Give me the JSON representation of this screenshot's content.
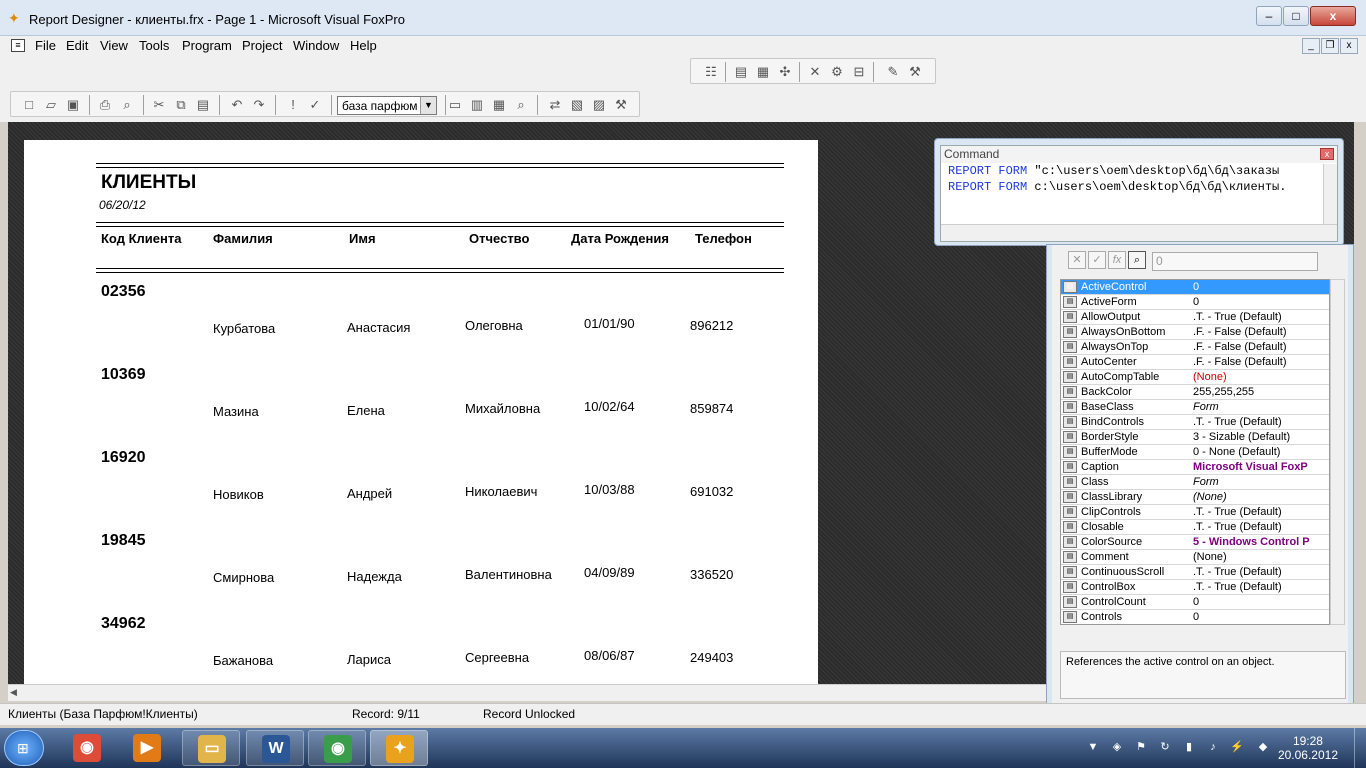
{
  "window": {
    "title": "Report Designer - клиенты.frx - Page 1 - Microsoft Visual FoxPro",
    "min": "–",
    "max": "□",
    "close": "x"
  },
  "menu": [
    "File",
    "Edit",
    "View",
    "Tools",
    "Program",
    "Project",
    "Window",
    "Help"
  ],
  "toolbar": {
    "database": "база парфюм"
  },
  "report": {
    "title": "КЛИЕНТЫ",
    "date": "06/20/12",
    "columns": [
      "Код Клиента",
      "Фамилия",
      "Имя",
      "Отчество",
      "Дата Рождения",
      "Телефон"
    ],
    "records": [
      {
        "code": "02356",
        "last": "Курбатова",
        "first": "Анастасия",
        "middle": "Олеговна",
        "dob": "01/01/90",
        "phone": "896212"
      },
      {
        "code": "10369",
        "last": "Мазина",
        "first": "Елена",
        "middle": "Михайловна",
        "dob": "10/02/64",
        "phone": "859874"
      },
      {
        "code": "16920",
        "last": "Новиков",
        "first": "Андрей",
        "middle": "Николаевич",
        "dob": "10/03/88",
        "phone": "691032"
      },
      {
        "code": "19845",
        "last": "Смирнова",
        "first": "Надежда",
        "middle": "Валентиновна",
        "dob": "04/09/89",
        "phone": "336520"
      },
      {
        "code": "34962",
        "last": "Бажанова",
        "first": "Лариса",
        "middle": "Сергеевна",
        "dob": "08/06/87",
        "phone": "249403"
      }
    ]
  },
  "command": {
    "title": "Command",
    "line1_kw": "REPORT FORM",
    "line1_rest": " \"c:\\users\\oem\\desktop\\бд\\бд\\заказы",
    "line2_kw": "REPORT FORM",
    "line2_rest": " c:\\users\\oem\\desktop\\бд\\бд\\клиенты."
  },
  "properties": {
    "value": "0",
    "description": "References the active control on an object.",
    "rows": [
      {
        "name": "ActiveControl",
        "value": "0"
      },
      {
        "name": "ActiveForm",
        "value": "0"
      },
      {
        "name": "AllowOutput",
        "value": ".T. - True (Default)"
      },
      {
        "name": "AlwaysOnBottom",
        "value": ".F. - False (Default)"
      },
      {
        "name": "AlwaysOnTop",
        "value": ".F. - False (Default)"
      },
      {
        "name": "AutoCenter",
        "value": ".F. - False (Default)"
      },
      {
        "name": "AutoCompTable",
        "value": "(None)"
      },
      {
        "name": "BackColor",
        "value": "255,255,255"
      },
      {
        "name": "BaseClass",
        "value": "Form"
      },
      {
        "name": "BindControls",
        "value": ".T. - True (Default)"
      },
      {
        "name": "BorderStyle",
        "value": "3 - Sizable (Default)"
      },
      {
        "name": "BufferMode",
        "value": "0 - None (Default)"
      },
      {
        "name": "Caption",
        "value": "Microsoft Visual FoxP"
      },
      {
        "name": "Class",
        "value": "Form"
      },
      {
        "name": "ClassLibrary",
        "value": "(None)"
      },
      {
        "name": "ClipControls",
        "value": ".T. - True (Default)"
      },
      {
        "name": "Closable",
        "value": ".T. - True (Default)"
      },
      {
        "name": "ColorSource",
        "value": "5 - Windows Control P"
      },
      {
        "name": "Comment",
        "value": "(None)"
      },
      {
        "name": "ContinuousScroll",
        "value": ".T. - True (Default)"
      },
      {
        "name": "ControlBox",
        "value": ".T. - True (Default)"
      },
      {
        "name": "ControlCount",
        "value": "0"
      },
      {
        "name": "Controls",
        "value": "0"
      }
    ]
  },
  "status": {
    "table": "Клиенты (База Парфюм!Клиенты)",
    "record": "Record: 9/11",
    "lock": "Record Unlocked"
  },
  "clock": {
    "time": "19:28",
    "date": "20.06.2012"
  }
}
